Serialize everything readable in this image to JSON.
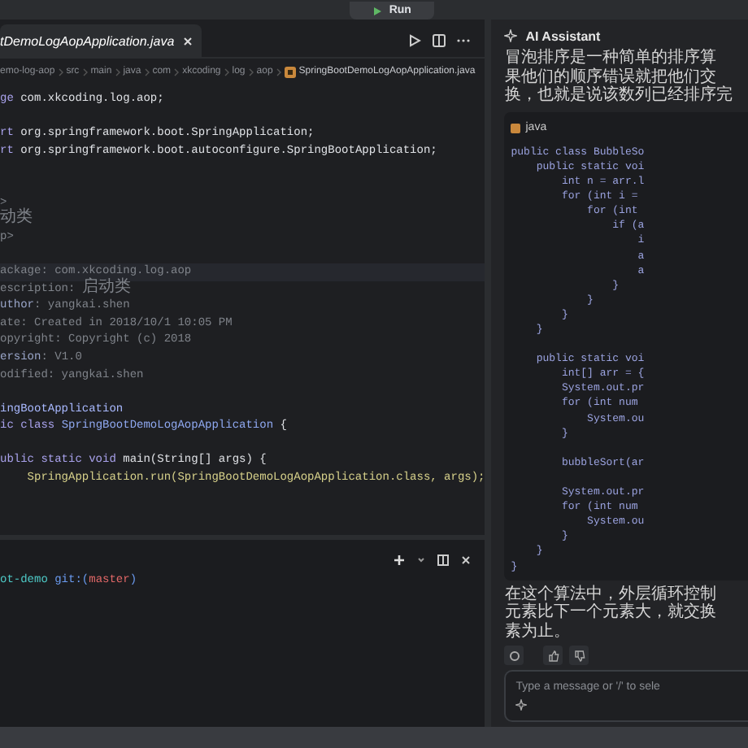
{
  "top_bar": {
    "run_button": "Run"
  },
  "editor": {
    "tab": {
      "label": "tDemoLogAopApplication.java",
      "selected": true
    },
    "breadcrumb": [
      "emo-log-aop",
      "src",
      "main",
      "java",
      "com",
      "xkcoding",
      "log",
      "aop",
      "SpringBootDemoLogAopApplication.java"
    ],
    "lines": [
      {
        "current": false,
        "tokens": [
          {
            "text": "ge",
            "kind": "kw"
          },
          {
            "text": " com.xkcoding.log.aop;",
            "kind": "plain"
          }
        ]
      },
      {
        "current": false
      },
      {
        "current": false,
        "tokens": [
          {
            "text": "rt",
            "kind": "kw"
          },
          {
            "text": " org.springframework.boot.SpringApplication;",
            "kind": "plain"
          }
        ]
      },
      {
        "current": false,
        "tokens": [
          {
            "text": "rt",
            "kind": "kw"
          },
          {
            "text": " org.springframework.boot.autoconfigure.SpringBootApplication;",
            "kind": "plain"
          }
        ]
      },
      {
        "current": false
      },
      {
        "current": false
      },
      {
        "current": false,
        "tokens": [
          {
            "text": ">",
            "kind": "doc"
          }
        ]
      },
      {
        "current": false,
        "tokens": [
          {
            "text": "动类",
            "kind": "doc_cn"
          }
        ]
      },
      {
        "current": false,
        "tokens": [
          {
            "text": "p>",
            "kind": "doc"
          }
        ]
      },
      {
        "current": false
      },
      {
        "current": true,
        "tokens": [
          {
            "text": "ackage: com.xkcoding.log.aop",
            "kind": "doc"
          }
        ]
      },
      {
        "current": false,
        "tokens": [
          {
            "text": "escription: ",
            "kind": "doc"
          },
          {
            "text": "启动类",
            "kind": "doc_cn"
          }
        ]
      },
      {
        "current": false,
        "tokens": [
          {
            "text": "uthor",
            "kind": "doctag"
          },
          {
            "text": ": yangkai.shen",
            "kind": "doc"
          }
        ]
      },
      {
        "current": false,
        "tokens": [
          {
            "text": "ate: Created in 2018/10/1 10:05 PM",
            "kind": "doc"
          }
        ]
      },
      {
        "current": false,
        "tokens": [
          {
            "text": "opyright: Copyright (c) 2018",
            "kind": "doc"
          }
        ]
      },
      {
        "current": false,
        "tokens": [
          {
            "text": "ersion",
            "kind": "doctag"
          },
          {
            "text": ": V1.0",
            "kind": "doc"
          }
        ]
      },
      {
        "current": false,
        "tokens": [
          {
            "text": "odified: yangkai.shen",
            "kind": "doc"
          }
        ]
      },
      {
        "current": false
      },
      {
        "current": false,
        "tokens": [
          {
            "text": "ingBootApplication",
            "kind": "annotation"
          }
        ]
      },
      {
        "current": false,
        "tokens": [
          {
            "text": "ic class ",
            "kind": "kw"
          },
          {
            "text": "SpringBootDemoLogAopApplication",
            "kind": "cls"
          },
          {
            "text": " {",
            "kind": "plain"
          }
        ]
      },
      {
        "current": false
      },
      {
        "current": false,
        "tokens": [
          {
            "text": "ublic static void ",
            "kind": "kw"
          },
          {
            "text": "main(String[] args) {",
            "kind": "plain"
          }
        ]
      },
      {
        "current": false,
        "tokens": [
          {
            "text": "    SpringApplication.run(SpringBootDemoLogAopApplication.class, args);",
            "kind": "call"
          }
        ]
      }
    ]
  },
  "terminal": {
    "prompt": [
      {
        "text": "ot-demo",
        "kind": "dir"
      },
      {
        "text": " git:(",
        "kind": "git"
      },
      {
        "text": "master",
        "kind": "branch"
      },
      {
        "text": ")",
        "kind": "git"
      }
    ]
  },
  "assistant": {
    "title": "AI Assistant",
    "intro": [
      "冒泡排序是一种简单的排序算",
      "果他们的顺序错误就把他们交",
      "换，也就是说该数列已经排序完"
    ],
    "code_language": "java",
    "code": [
      [
        "public class BubbleSo",
        "    public static voi",
        "        int n = arr.l",
        "        for (int i = ",
        "            for (int ",
        "                if (a",
        "                    i",
        "                    a",
        "                    a",
        "                }",
        "            }",
        "        }",
        "    }"
      ],
      [
        "    public static voi",
        "        int[] arr = {",
        "        System.out.pr",
        "        for (int num ",
        "            System.ou",
        "        }"
      ],
      [
        "        bubbleSort(ar"
      ],
      [
        "        System.out.pr",
        "        for (int num ",
        "            System.ou",
        "        }",
        "    }",
        "}"
      ]
    ],
    "outro": [
      "在这个算法中，外层循环控制",
      "元素比下一个元素大，就交换",
      "素为止。"
    ],
    "input": {
      "placeholder": "Type a message or '/' to sele"
    }
  }
}
